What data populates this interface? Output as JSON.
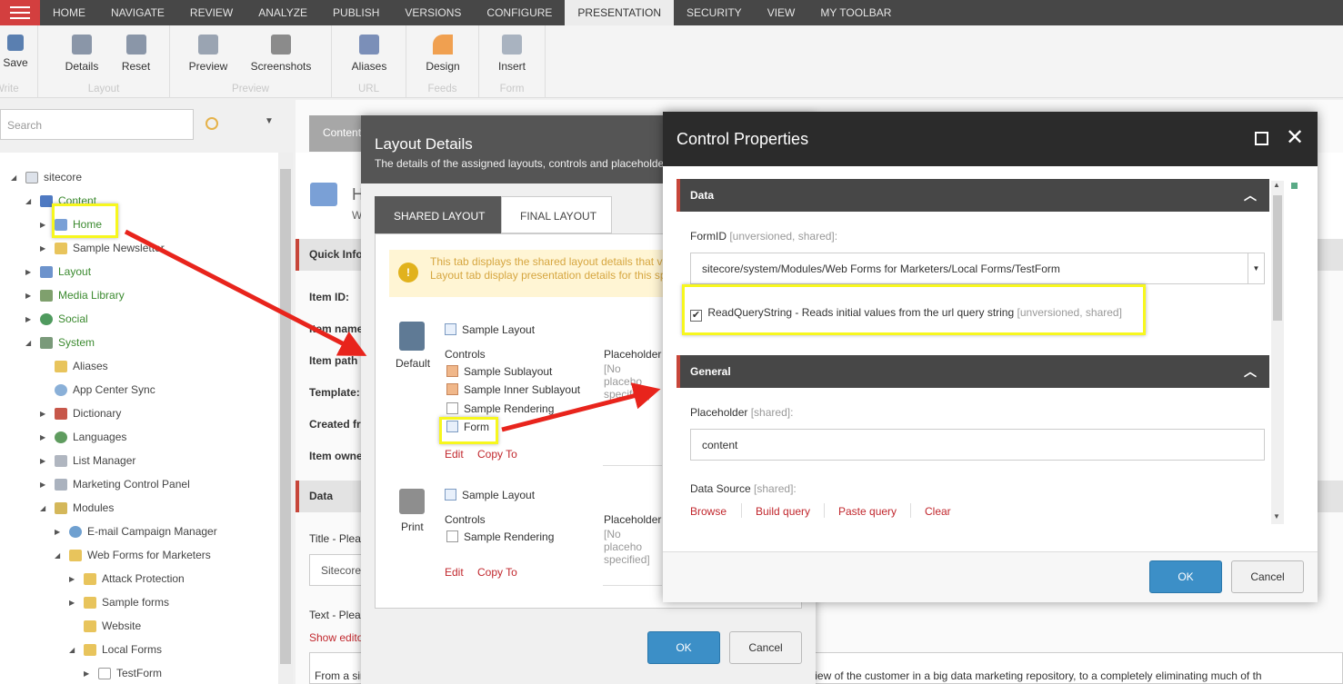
{
  "topnav": {
    "tabs": [
      "HOME",
      "NAVIGATE",
      "REVIEW",
      "ANALYZE",
      "PUBLISH",
      "VERSIONS",
      "CONFIGURE",
      "PRESENTATION",
      "SECURITY",
      "VIEW",
      "MY TOOLBAR"
    ],
    "active": "PRESENTATION"
  },
  "ribbon": {
    "save": "Save",
    "write": "Write",
    "details": "Details",
    "reset": "Reset",
    "layout": "Layout",
    "preview": "Preview",
    "screenshots": "Screenshots",
    "preview_group": "Preview",
    "aliases": "Aliases",
    "url": "URL",
    "design": "Design",
    "feeds": "Feeds",
    "insert": "Insert",
    "form": "Form"
  },
  "search": {
    "placeholder": "Search"
  },
  "tree": {
    "sitecore": "sitecore",
    "content": "Content",
    "home": "Home",
    "sample_news": "Sample Newsletter",
    "layout": "Layout",
    "media": "Media Library",
    "social": "Social",
    "system": "System",
    "aliases": "Aliases",
    "appcenter": "App Center Sync",
    "dictionary": "Dictionary",
    "languages": "Languages",
    "listmanager": "List Manager",
    "marketing": "Marketing Control Panel",
    "modules": "Modules",
    "email": "E-mail Campaign Manager",
    "wffm": "Web Forms for Marketers",
    "attack": "Attack Protection",
    "sampleforms": "Sample forms",
    "website": "Website",
    "localforms": "Local Forms",
    "testform": "TestForm"
  },
  "main": {
    "content_tab": "Content",
    "home_title": "H",
    "home_sub": "W",
    "quickinfo": "Quick Info",
    "itemid": "Item ID:",
    "itemname": "Item name",
    "itempath": "Item path",
    "template": "Template:",
    "created": "Created fr",
    "owner": "Item owne",
    "data": "Data",
    "title_label": "Title - Plea",
    "title_value": "Sitecore",
    "text_label": "Text - Plea",
    "show_editor": "Show edito",
    "body_text": "From a single connected platform that also integrates with other customer-facing platforms, to a single view of the customer in a big data marketing repository, to a completely eliminating much of th"
  },
  "layout_details": {
    "title": "Layout Details",
    "subtitle": "The details of the assigned layouts, controls and placeholders.",
    "tab_shared": "SHARED LAYOUT",
    "tab_final": "FINAL LAYOUT",
    "notice": "This tab displays the shared layout details that version of the item. The Final Layout tab display presentation details for this specific version (shared +",
    "default": "Default",
    "print": "Print",
    "sample_layout": "Sample Layout",
    "controls": "Controls",
    "placeholder": "Placeholder",
    "no_placeholder": "[No placeho specified]",
    "sublayout": "Sample Sublayout",
    "inner_sublayout": "Sample Inner Sublayout",
    "rendering": "Sample Rendering",
    "form": "Form",
    "edit": "Edit",
    "copyto": "Copy To",
    "ok": "OK",
    "cancel": "Cancel"
  },
  "control_properties": {
    "title": "Control Properties",
    "data_section": "Data",
    "formid_label": "FormID",
    "formid_meta": "[unversioned, shared]:",
    "formid_value": "sitecore/system/Modules/Web Forms for Marketers/Local Forms/TestForm",
    "readquery": "ReadQueryString - Reads initial values from the url query string",
    "readquery_meta": "[unversioned, shared]",
    "general_section": "General",
    "placeholder_label": "Placeholder",
    "placeholder_meta": "[shared]:",
    "placeholder_value": "content",
    "datasource_label": "Data Source",
    "datasource_meta": "[shared]:",
    "browse": "Browse",
    "build_query": "Build query",
    "paste_query": "Paste query",
    "clear": "Clear",
    "ok": "OK",
    "cancel": "Cancel"
  }
}
